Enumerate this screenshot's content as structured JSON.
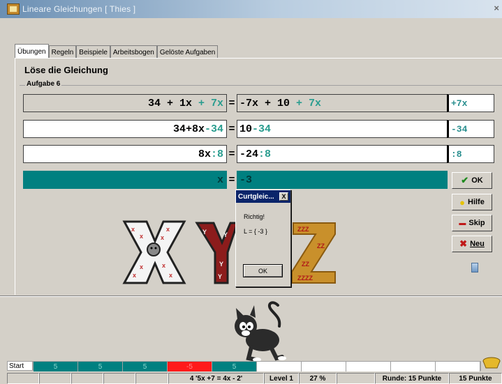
{
  "window": {
    "title": "Lineare Gleichungen  [ Thies ]"
  },
  "tabs": [
    {
      "label": "Übungen",
      "active": true
    },
    {
      "label": "Regeln",
      "active": false
    },
    {
      "label": "Beispiele",
      "active": false
    },
    {
      "label": "Arbeitsbogen",
      "active": false
    },
    {
      "label": "Gelöste Aufgaben",
      "active": false
    }
  ],
  "main": {
    "heading": "Löse die Gleichung",
    "task_label": "Aufgabe 6",
    "rows": [
      {
        "left": "34 + 1x",
        "left_op": " + 7x",
        "eq": "=",
        "right": "-7x + 10",
        "right_op": " + 7x",
        "operation": "+7x"
      },
      {
        "left": "34+8x",
        "left_op": "-34",
        "eq": "=",
        "right": "10",
        "right_op": "-34",
        "operation": "-34"
      },
      {
        "left": "8x",
        "left_op": ":8",
        "eq": "=",
        "right": "-24",
        "right_op": ":8",
        "operation": ":8"
      },
      {
        "left": "x",
        "left_op": "",
        "eq": "=",
        "right": "-3",
        "right_op": "",
        "operation": ""
      }
    ]
  },
  "buttons": {
    "ok": "OK",
    "hilfe": "Hilfe",
    "skip": "Skip",
    "neu": "Neu"
  },
  "dialog": {
    "title": "Curtgleic...",
    "close": "X",
    "message": "Richtig!",
    "solution": "L = { -3 }",
    "ok": "OK"
  },
  "progress": {
    "start_label": "Start",
    "segments": [
      {
        "label": "5",
        "color": "#008080"
      },
      {
        "label": "5",
        "color": "#008080"
      },
      {
        "label": "5",
        "color": "#008080"
      },
      {
        "label": "-5",
        "color": "#ff1a1a"
      },
      {
        "label": "5",
        "color": "#008080"
      },
      {
        "label": "",
        "color": "#ffffff"
      },
      {
        "label": "",
        "color": "#ffffff"
      },
      {
        "label": "",
        "color": "#ffffff"
      },
      {
        "label": "",
        "color": "#ffffff"
      },
      {
        "label": "",
        "color": "#ffffff"
      }
    ]
  },
  "status": {
    "task": "4  '5x +7 = 4x - 2'",
    "level": "Level 1",
    "percent": "27 %",
    "round": "Runde: 15 Punkte",
    "points": "15 Punkte"
  },
  "colors": {
    "teal": "#008080",
    "accent_text": "#2a9d8f",
    "error": "#ff1a1a"
  }
}
